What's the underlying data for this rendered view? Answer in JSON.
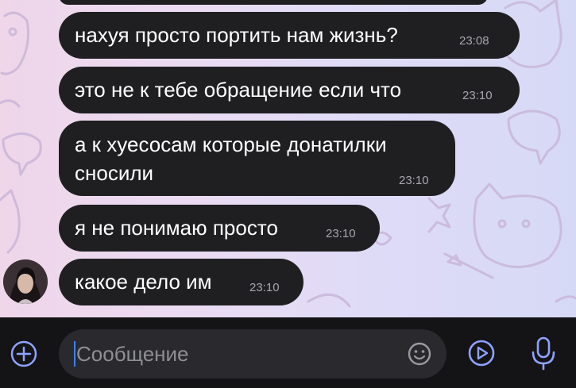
{
  "colors": {
    "bubble_bg": "#1f1f22",
    "bubble_text": "#ffffff",
    "time_text": "#a6a6ad",
    "composer_bg": "#141416",
    "input_bg": "#2a2a2e",
    "accent": "#8ea2ff",
    "placeholder": "#8e8e95"
  },
  "messages": [
    {
      "text": "нахуя просто портить нам жизнь?",
      "time": "23:08"
    },
    {
      "text": "это не к тебе обращение если что",
      "time": "23:10"
    },
    {
      "text_line1": "а к хуесосам которые донатилки",
      "text_line2": "сносили",
      "time": "23:10"
    },
    {
      "text": "я не понимаю просто",
      "time": "23:10"
    },
    {
      "text": "какое дело им",
      "time": "23:10"
    }
  ],
  "composer": {
    "placeholder": "Сообщение",
    "icons": {
      "attach": "plus-circle-icon",
      "emoji": "smiley-icon",
      "video_message": "play-circle-icon",
      "voice": "microphone-icon"
    }
  }
}
